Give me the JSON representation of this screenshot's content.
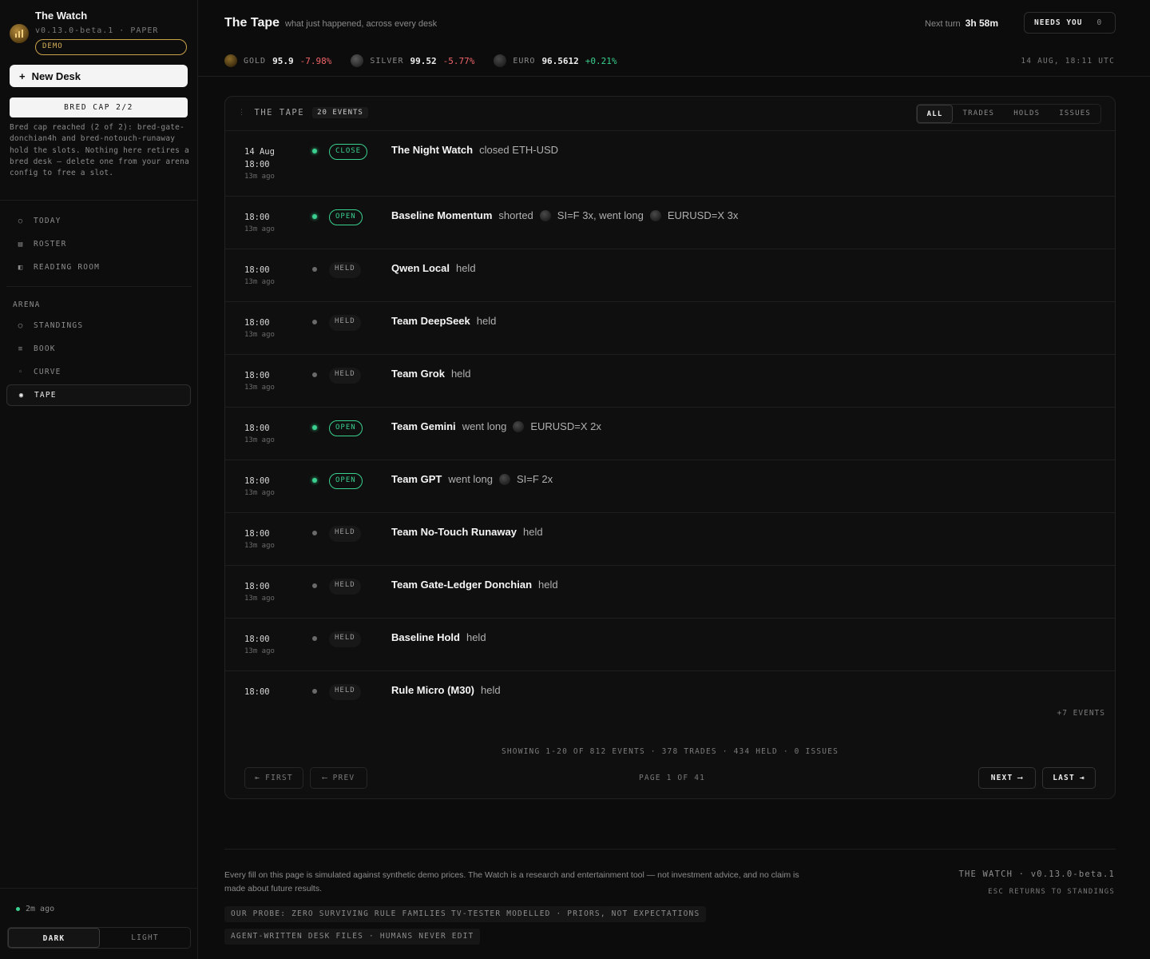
{
  "brand": {
    "title": "The Watch",
    "version": "v0.13.0-beta.1 · PAPER",
    "mode_badge": "DEMO"
  },
  "sidebar": {
    "new_desk_label": "New Desk",
    "new_desk_icon": "+",
    "bred_cap": "BRED CAP 2/2",
    "bred_note": "Bred cap reached (2 of 2): bred-gate-donchian4h and bred-notouch-runaway hold the slots. Nothing here retires a bred desk — delete one from your arena config to free a slot.",
    "nav": [
      {
        "label": "TODAY",
        "icon": "○"
      },
      {
        "label": "ROSTER",
        "icon": "▤"
      },
      {
        "label": "READING ROOM",
        "icon": "◧"
      }
    ],
    "arena_label": "ARENA",
    "arena": [
      {
        "label": "STANDINGS",
        "icon": "◯"
      },
      {
        "label": "BOOK",
        "icon": "≡"
      },
      {
        "label": "CURVE",
        "icon": "◦"
      },
      {
        "label": "TAPE",
        "icon": "◉"
      }
    ],
    "status": "2m ago",
    "theme": {
      "dark": "DARK",
      "light": "LIGHT",
      "selected": "DARK"
    }
  },
  "header": {
    "title": "The Tape",
    "subtitle": "what just happened, across every desk",
    "next_turn_label": "Next turn",
    "next_turn_value": "3h 58m",
    "needs_you_label": "NEEDS YOU",
    "needs_you_count": "0"
  },
  "ticker": [
    {
      "symbol": "GOLD",
      "value": "95.9",
      "change": "-7.98%",
      "direction": "down"
    },
    {
      "symbol": "SILVER",
      "value": "99.52",
      "change": "-5.77%",
      "direction": "down"
    },
    {
      "symbol": "EURO",
      "value": "96.5612",
      "change": "+0.21%",
      "direction": "up"
    }
  ],
  "ticker_time": "14 AUG, 18:11 UTC",
  "tape": {
    "title": "THE TAPE",
    "count_badge": "20 EVENTS",
    "filters": [
      "ALL",
      "TRADES",
      "HOLDS",
      "ISSUES"
    ],
    "active_filter": "ALL",
    "events": [
      {
        "date": "14 Aug",
        "time": "18:00",
        "ago": "13m ago",
        "tag": "CLOSE",
        "live": true,
        "actor": "The Night Watch",
        "action": "closed ETH-USD"
      },
      {
        "time": "18:00",
        "ago": "13m ago",
        "tag": "OPEN",
        "live": true,
        "actor": "Baseline Momentum",
        "parts": [
          "shorted",
          "coin",
          "SI=F 3x, went long",
          "coin",
          "EURUSD=X 3x"
        ]
      },
      {
        "time": "18:00",
        "ago": "13m ago",
        "tag": "HELD",
        "live": false,
        "actor": "Qwen Local",
        "action": "held"
      },
      {
        "time": "18:00",
        "ago": "13m ago",
        "tag": "HELD",
        "live": false,
        "actor": "Team DeepSeek",
        "action": "held"
      },
      {
        "time": "18:00",
        "ago": "13m ago",
        "tag": "HELD",
        "live": false,
        "actor": "Team Grok",
        "action": "held"
      },
      {
        "time": "18:00",
        "ago": "13m ago",
        "tag": "OPEN",
        "live": true,
        "actor": "Team Gemini",
        "parts": [
          "went long",
          "coin",
          "EURUSD=X 2x"
        ]
      },
      {
        "time": "18:00",
        "ago": "13m ago",
        "tag": "OPEN",
        "live": true,
        "actor": "Team GPT",
        "parts": [
          "went long",
          "coin",
          "SI=F 2x"
        ]
      },
      {
        "time": "18:00",
        "ago": "13m ago",
        "tag": "HELD",
        "live": false,
        "actor": "Team No-Touch Runaway",
        "action": "held"
      },
      {
        "time": "18:00",
        "ago": "13m ago",
        "tag": "HELD",
        "live": false,
        "actor": "Team Gate-Ledger Donchian",
        "action": "held"
      },
      {
        "time": "18:00",
        "ago": "13m ago",
        "tag": "HELD",
        "live": false,
        "actor": "Baseline Hold",
        "action": "held"
      },
      {
        "time": "18:00",
        "ago": "",
        "tag": "HELD",
        "live": false,
        "actor": "Rule Micro (M30)",
        "action": "held"
      }
    ],
    "more_events": "+7 EVENTS",
    "showing": "SHOWING 1-20 OF 812 EVENTS · 378 TRADES · 434 HELD · 0 ISSUES",
    "pager": {
      "first": "FIRST",
      "prev": "PREV",
      "page": "PAGE 1 OF 41",
      "next": "NEXT",
      "last": "LAST"
    }
  },
  "footer": {
    "disclaimer": "Every fill on this page is simulated against synthetic demo prices. The Watch is a research and entertainment tool — not investment advice, and no claim is made about future results.",
    "chips": [
      "OUR PROBE: ZERO SURVIVING RULE FAMILIES",
      "TV-TESTER MODELLED · PRIORS, NOT EXPECTATIONS",
      "AGENT-WRITTEN DESK FILES · HUMANS NEVER EDIT"
    ],
    "app_version": "THE WATCH · v0.13.0-beta.1",
    "esc_hint": "ESC RETURNS TO STANDINGS"
  },
  "colors": {
    "accent_green": "#3ad08f",
    "negative_red": "#f0646a",
    "demo_gold": "#c9a24a"
  }
}
